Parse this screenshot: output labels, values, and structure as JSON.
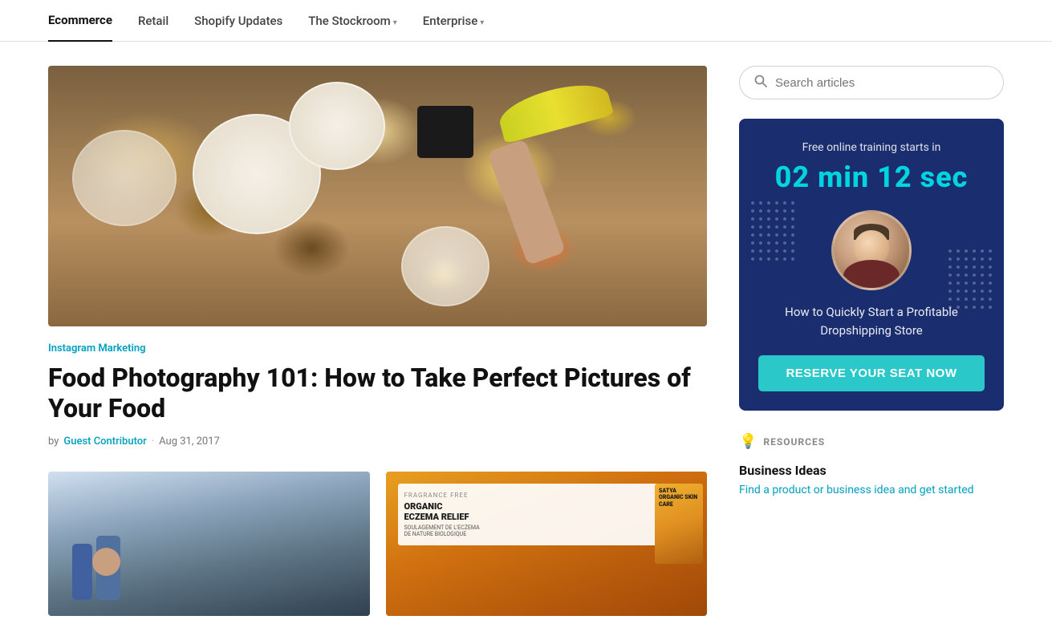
{
  "nav": {
    "items": [
      {
        "label": "Ecommerce",
        "active": true,
        "hasChevron": false
      },
      {
        "label": "Retail",
        "active": false,
        "hasChevron": false
      },
      {
        "label": "Shopify Updates",
        "active": false,
        "hasChevron": false
      },
      {
        "label": "The Stockroom",
        "active": false,
        "hasChevron": true
      },
      {
        "label": "Enterprise",
        "active": false,
        "hasChevron": true
      }
    ]
  },
  "hero": {
    "category": "Instagram Marketing",
    "title": "Food Photography 101: How to Take Perfect Pictures of Your Food",
    "author": "Guest Contributor",
    "date": "Aug 31, 2017",
    "by_label": "by"
  },
  "search": {
    "placeholder": "Search articles"
  },
  "promo": {
    "intro": "Free online training starts in",
    "timer": "02 min 12 sec",
    "description": "How to Quickly Start a Profitable Dropshipping Store",
    "cta": "Reserve your seat now"
  },
  "resources": {
    "label": "RESOURCES",
    "items": [
      {
        "title": "Business Ideas",
        "link": "Find a product or business idea and get started"
      }
    ]
  }
}
